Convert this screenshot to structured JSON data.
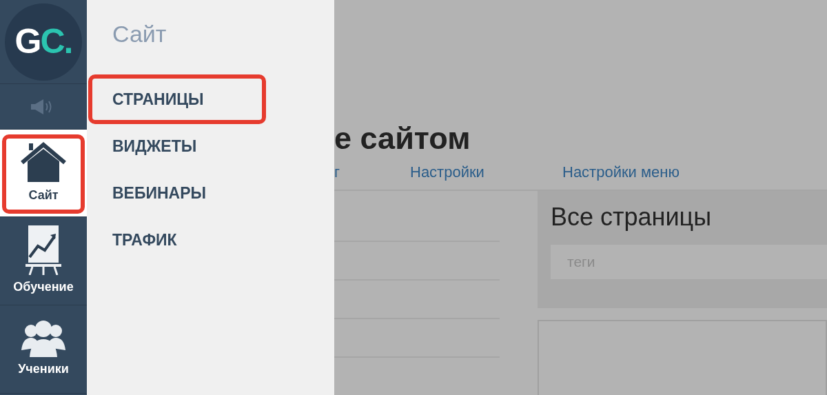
{
  "logo": {
    "letters": [
      "G",
      "C",
      "."
    ]
  },
  "nav": [
    {
      "kind": "sound",
      "selected": false,
      "annotated": false
    },
    {
      "kind": "home",
      "label": "Сайт",
      "selected": true,
      "annotated": true
    },
    {
      "kind": "chart",
      "label": "Обучение",
      "selected": false,
      "annotated": false
    },
    {
      "kind": "people",
      "label": "Ученики",
      "selected": false,
      "annotated": false
    }
  ],
  "flyout": {
    "title": "Сайт",
    "items": [
      {
        "label": "СТРАНИЦЫ",
        "annotated": true
      },
      {
        "label": "ВИДЖЕТЫ",
        "annotated": false
      },
      {
        "label": "ВЕБИНАРЫ",
        "annotated": false
      },
      {
        "label": "ТРАФИК",
        "annotated": false
      }
    ]
  },
  "main": {
    "heading": "е сайтом",
    "tabs": [
      {
        "label": "г"
      },
      {
        "label": "Настройки"
      },
      {
        "label": "Настройки меню"
      }
    ],
    "panel": {
      "title": "Все страницы",
      "search": {
        "placeholder": "теги"
      }
    }
  }
}
